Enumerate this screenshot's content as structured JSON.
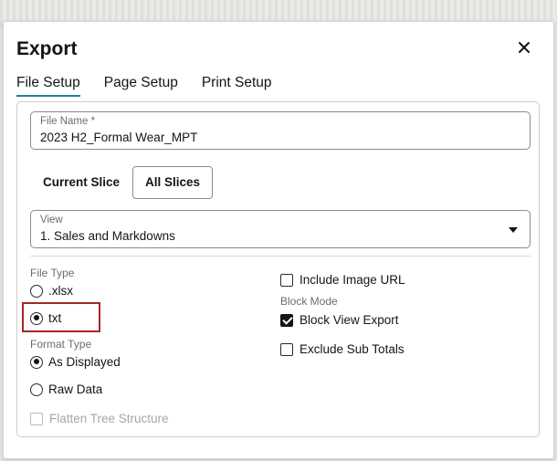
{
  "dialog": {
    "title": "Export",
    "close_icon": "close-icon"
  },
  "tabs": [
    {
      "label": "File Setup",
      "active": true
    },
    {
      "label": "Page Setup",
      "active": false
    },
    {
      "label": "Print Setup",
      "active": false
    }
  ],
  "file_name": {
    "label": "File Name *",
    "value": "2023 H2_Formal Wear_MPT"
  },
  "slices": {
    "current_label": "Current Slice",
    "all_label": "All Slices",
    "selected": "All Slices"
  },
  "view": {
    "label": "View",
    "value": "1. Sales and Markdowns",
    "icon": "caret-down-icon"
  },
  "file_type": {
    "label": "File Type",
    "options": [
      {
        "label": ".xlsx",
        "selected": false
      },
      {
        "label": "txt",
        "selected": true
      }
    ]
  },
  "format_type": {
    "label": "Format Type",
    "options": [
      {
        "label": "As Displayed",
        "selected": true
      },
      {
        "label": "Raw Data",
        "selected": false
      }
    ]
  },
  "flatten_tree": {
    "label": "Flatten Tree Structure",
    "checked": false,
    "disabled": true
  },
  "include_image_url": {
    "label": "Include Image URL",
    "checked": false
  },
  "block_mode": {
    "label": "Block Mode",
    "block_view_export": {
      "label": "Block View Export",
      "checked": true
    }
  },
  "exclude_sub_totals": {
    "label": "Exclude Sub Totals",
    "checked": false
  },
  "colors": {
    "accent": "#227e9e",
    "highlight": "#a3281f",
    "text": "#161513",
    "muted": "#6f6c69"
  }
}
